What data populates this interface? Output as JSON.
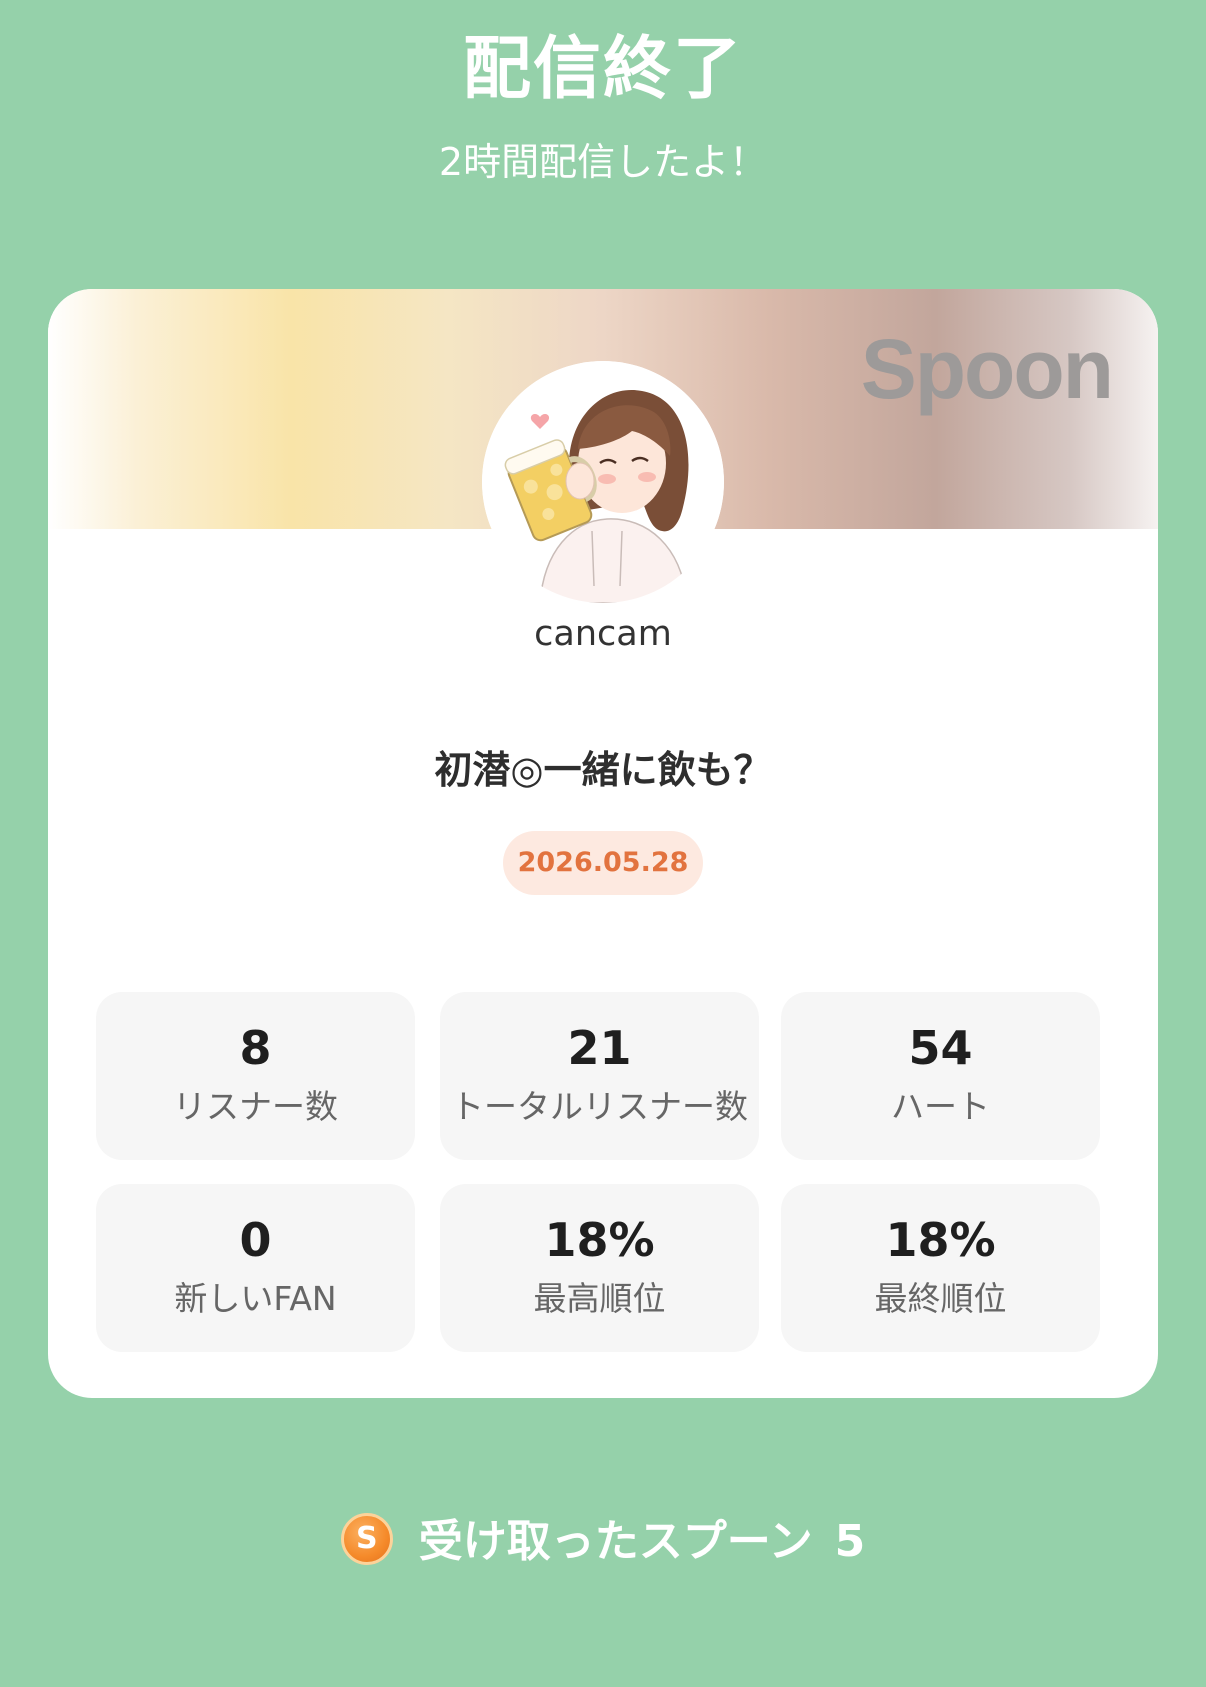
{
  "header": {
    "title": "配信終了",
    "subtitle": "2時間配信したよ！"
  },
  "card": {
    "brand": "Spoon",
    "username": "cancam",
    "live_title": "初潜◎一緒に飲も？",
    "date": "2026.05.28",
    "stats": [
      {
        "value": "8",
        "label": "リスナー数"
      },
      {
        "value": "21",
        "label": "トータルリスナー数"
      },
      {
        "value": "54",
        "label": "ハート"
      },
      {
        "value": "0",
        "label": "新しいFAN"
      },
      {
        "value": "18%",
        "label": "最高順位"
      },
      {
        "value": "18%",
        "label": "最終順位"
      }
    ]
  },
  "spoons": {
    "icon": "spoon-coin-icon",
    "coin_letter": "S",
    "label": "受け取ったスプーン",
    "count": "5"
  },
  "colors": {
    "background": "#95d1aa",
    "accent": "#e2733f",
    "coin": "#f58a2a"
  }
}
